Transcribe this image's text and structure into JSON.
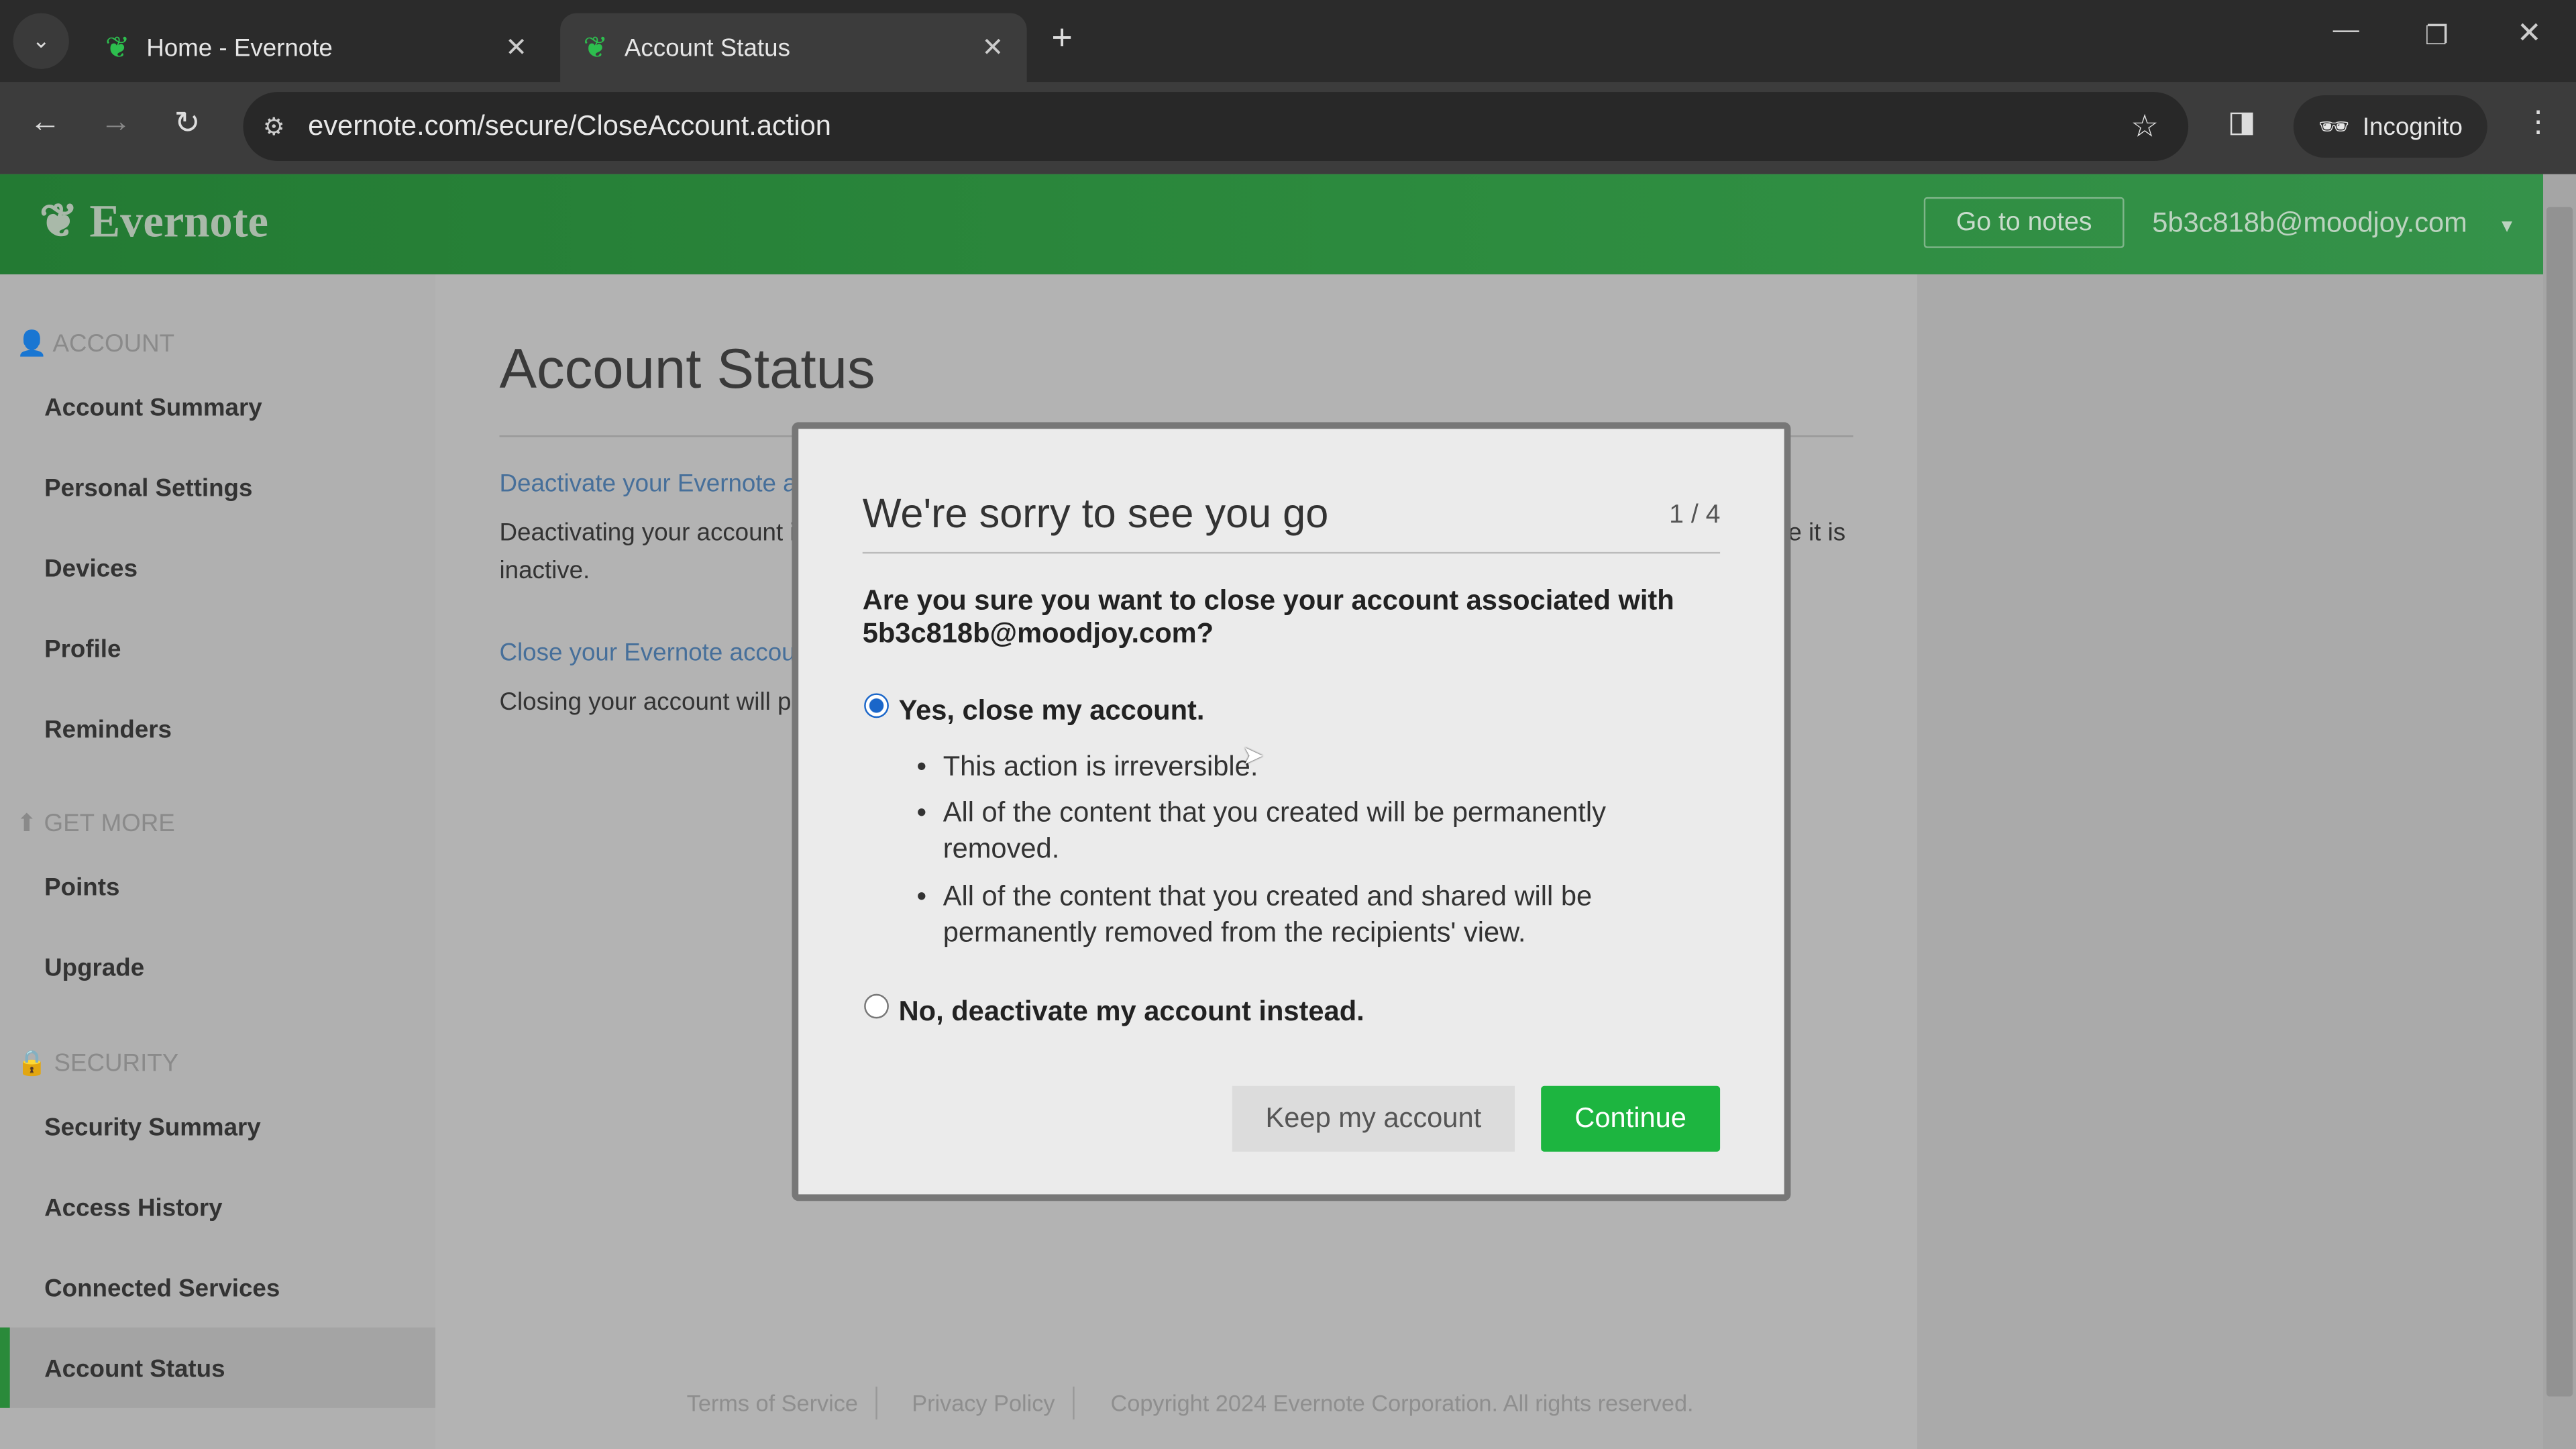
{
  "browser": {
    "tabs": [
      {
        "title": "Home - Evernote"
      },
      {
        "title": "Account Status"
      }
    ],
    "url": "evernote.com/secure/CloseAccount.action",
    "incognito_label": "Incognito"
  },
  "header": {
    "logo": "Evernote",
    "go_to_notes": "Go to notes",
    "user_email": "5b3c818b@moodjoy.com"
  },
  "sidebar": {
    "sections": [
      {
        "title": "ACCOUNT",
        "items": [
          "Account Summary",
          "Personal Settings",
          "Devices",
          "Profile",
          "Reminders"
        ]
      },
      {
        "title": "GET MORE",
        "items": [
          "Points",
          "Upgrade"
        ]
      },
      {
        "title": "SECURITY",
        "items": [
          "Security Summary",
          "Access History",
          "Connected Services",
          "Account Status"
        ]
      }
    ],
    "active": "Account Status"
  },
  "main": {
    "title": "Account Status",
    "deactivate_link": "Deactivate your Evernote ac",
    "deactivate_text_1": "Deactivating your account is",
    "deactivate_text_right": "le it is",
    "deactivate_text_2": "inactive.",
    "close_link": "Close your Evernote accoun",
    "close_text": "Closing your account will pe"
  },
  "modal": {
    "title": "We're sorry to see you go",
    "step": "1 / 4",
    "question": "Are you sure you want to close your account associated with 5b3c818b@moodjoy.com?",
    "option_yes": "Yes, close my account.",
    "option_yes_selected": true,
    "bullets": [
      "This action is irreversible.",
      "All of the content that you created will be permanently removed.",
      "All of the content that you created and shared will be permanently removed from the recipients' view."
    ],
    "option_no": "No, deactivate my account instead.",
    "keep_button": "Keep my account",
    "continue_button": "Continue",
    "accent": "#1db540"
  },
  "footer": {
    "terms": "Terms of Service",
    "privacy": "Privacy Policy",
    "copyright": "Copyright 2024 Evernote Corporation. All rights reserved."
  }
}
